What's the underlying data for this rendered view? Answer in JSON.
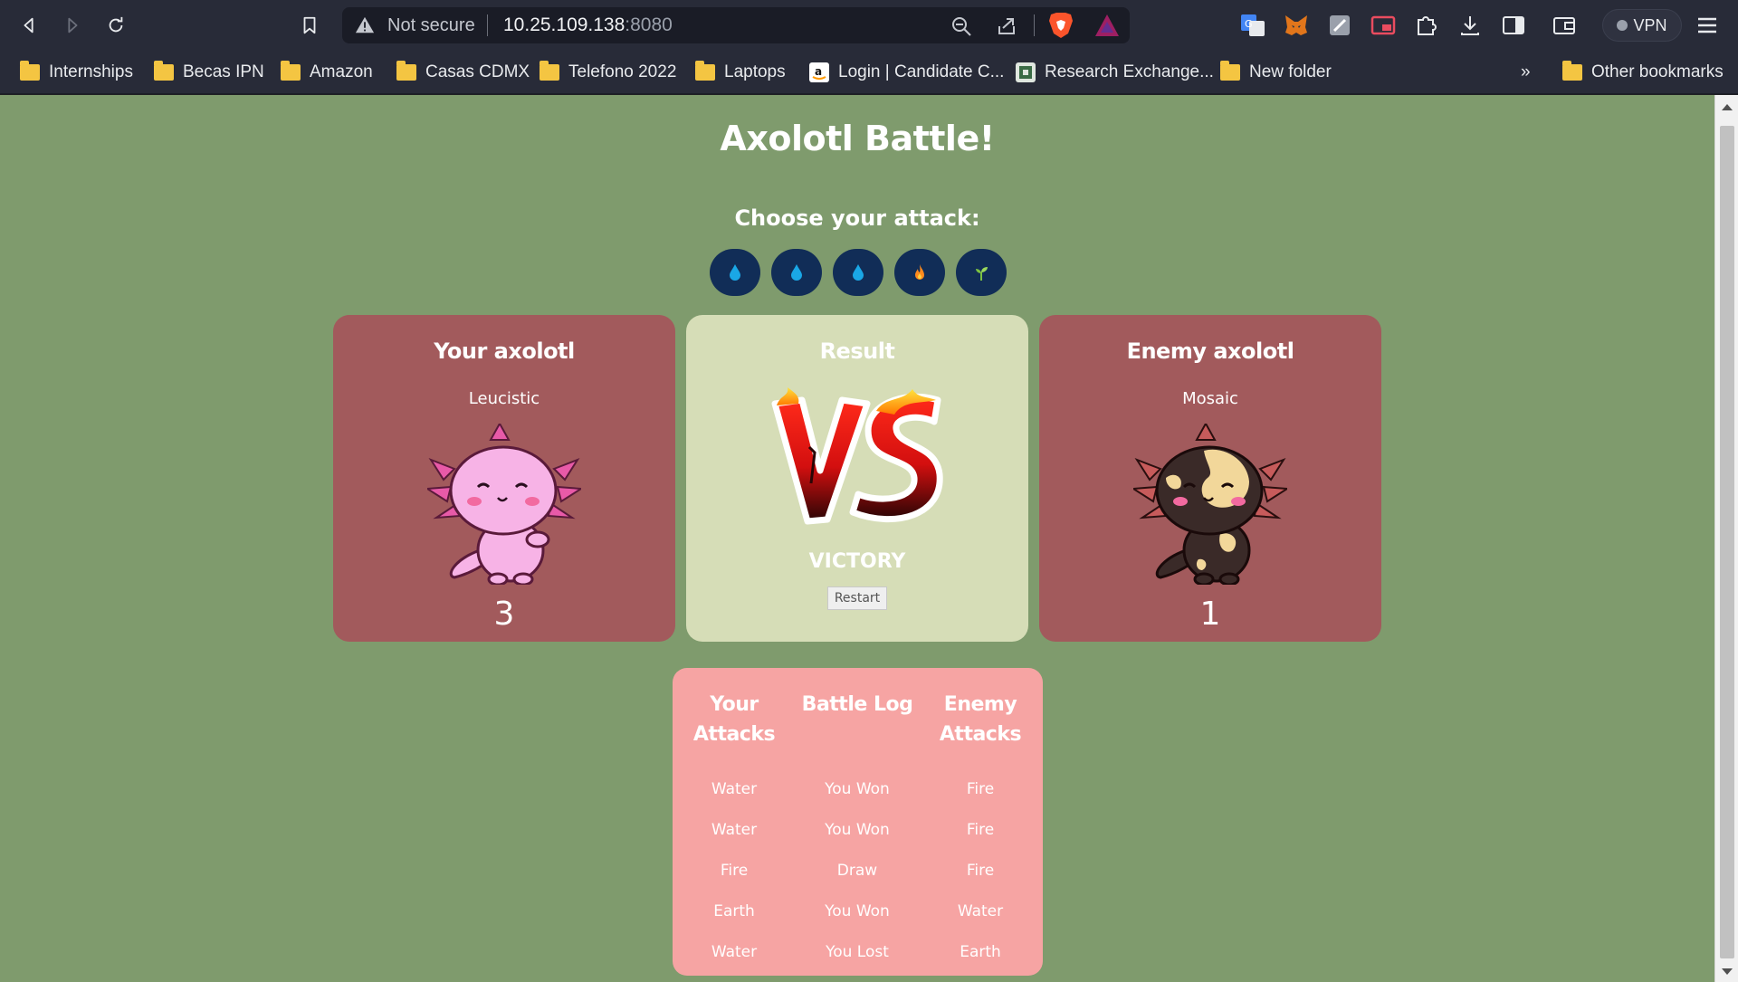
{
  "browser": {
    "security_label": "Not secure",
    "url_host": "10.25.109.138",
    "url_port": ":8080",
    "vpn_label": "VPN",
    "bookmarks": [
      {
        "label": "Internships",
        "icon": "folder-icon"
      },
      {
        "label": "Becas IPN",
        "icon": "folder-icon"
      },
      {
        "label": "Amazon",
        "icon": "folder-icon"
      },
      {
        "label": "Casas CDMX",
        "icon": "folder-icon"
      },
      {
        "label": "Telefono 2022",
        "icon": "folder-icon"
      },
      {
        "label": "Laptops",
        "icon": "folder-icon"
      },
      {
        "label": "Login | Candidate C...",
        "icon": "amazon-favicon"
      },
      {
        "label": "Research Exchange...",
        "icon": "site-favicon"
      },
      {
        "label": "New folder",
        "icon": "folder-icon"
      }
    ],
    "overflow_label": "»",
    "other_bookmarks": "Other bookmarks"
  },
  "game": {
    "title": "Axolotl Battle!",
    "choose_label": "Choose your attack:",
    "attack_buttons": [
      {
        "icon": "water-drop-icon",
        "color": "#1aa7e6"
      },
      {
        "icon": "water-drop-icon",
        "color": "#1aa7e6"
      },
      {
        "icon": "water-drop-icon",
        "color": "#1aa7e6"
      },
      {
        "icon": "fire-icon",
        "color": "#ff8a1d"
      },
      {
        "icon": "sprout-icon",
        "color": "#7cc142"
      }
    ],
    "player": {
      "heading": "Your axolotl",
      "name": "Leucistic",
      "lives": "3"
    },
    "result": {
      "heading": "Result",
      "message": "VICTORY",
      "restart_label": "Restart"
    },
    "enemy": {
      "heading": "Enemy axolotl",
      "name": "Mosaic",
      "lives": "1"
    },
    "log": {
      "your_attacks_heading": "Your Attacks",
      "battle_log_heading": "Battle Log",
      "enemy_attacks_heading": "Enemy Attacks",
      "your_attacks": [
        "Water",
        "Water",
        "Fire",
        "Earth",
        "Water"
      ],
      "battle_log": [
        "You Won",
        "You Won",
        "Draw",
        "You Won",
        "You Lost"
      ],
      "enemy_attacks": [
        "Fire",
        "Fire",
        "Fire",
        "Water",
        "Earth"
      ]
    },
    "colors": {
      "background": "#7f9b6d",
      "side_card": "#a25a5c",
      "result_card": "#d6ddb7",
      "log_card": "#f6a4a3",
      "attack_button": "#112d57"
    }
  }
}
